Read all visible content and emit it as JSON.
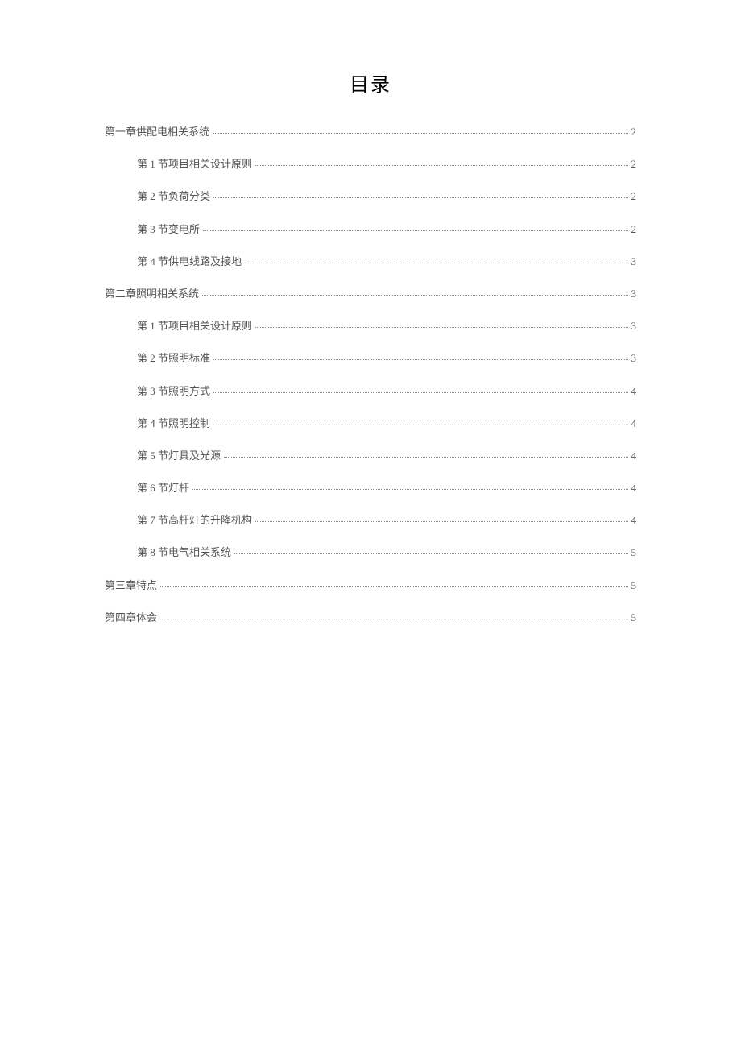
{
  "title": "目录",
  "entries": [
    {
      "level": 1,
      "label": "第一章供配电相关系统",
      "page": "2"
    },
    {
      "level": 2,
      "label": "第 1 节项目相关设计原则",
      "page": "2"
    },
    {
      "level": 2,
      "label": "第 2 节负荷分类",
      "page": "2"
    },
    {
      "level": 2,
      "label": "第 3 节变电所",
      "page": "2"
    },
    {
      "level": 2,
      "label": "第 4 节供电线路及接地",
      "page": "3"
    },
    {
      "level": 1,
      "label": "第二章照明相关系统",
      "page": "3"
    },
    {
      "level": 2,
      "label": "第 1 节项目相关设计原则",
      "page": "3"
    },
    {
      "level": 2,
      "label": "第 2 节照明标准",
      "page": "3"
    },
    {
      "level": 2,
      "label": "第 3 节照明方式",
      "page": "4"
    },
    {
      "level": 2,
      "label": "第 4 节照明控制",
      "page": "4"
    },
    {
      "level": 2,
      "label": "第 5 节灯具及光源",
      "page": "4"
    },
    {
      "level": 2,
      "label": "第 6 节灯杆",
      "page": "4"
    },
    {
      "level": 2,
      "label": "第 7 节高杆灯的升降机构",
      "page": "4"
    },
    {
      "level": 2,
      "label": "第 8 节电气相关系统",
      "page": "5"
    },
    {
      "level": 1,
      "label": "第三章特点",
      "page": "5"
    },
    {
      "level": 1,
      "label": "第四章体会",
      "page": "5"
    }
  ]
}
